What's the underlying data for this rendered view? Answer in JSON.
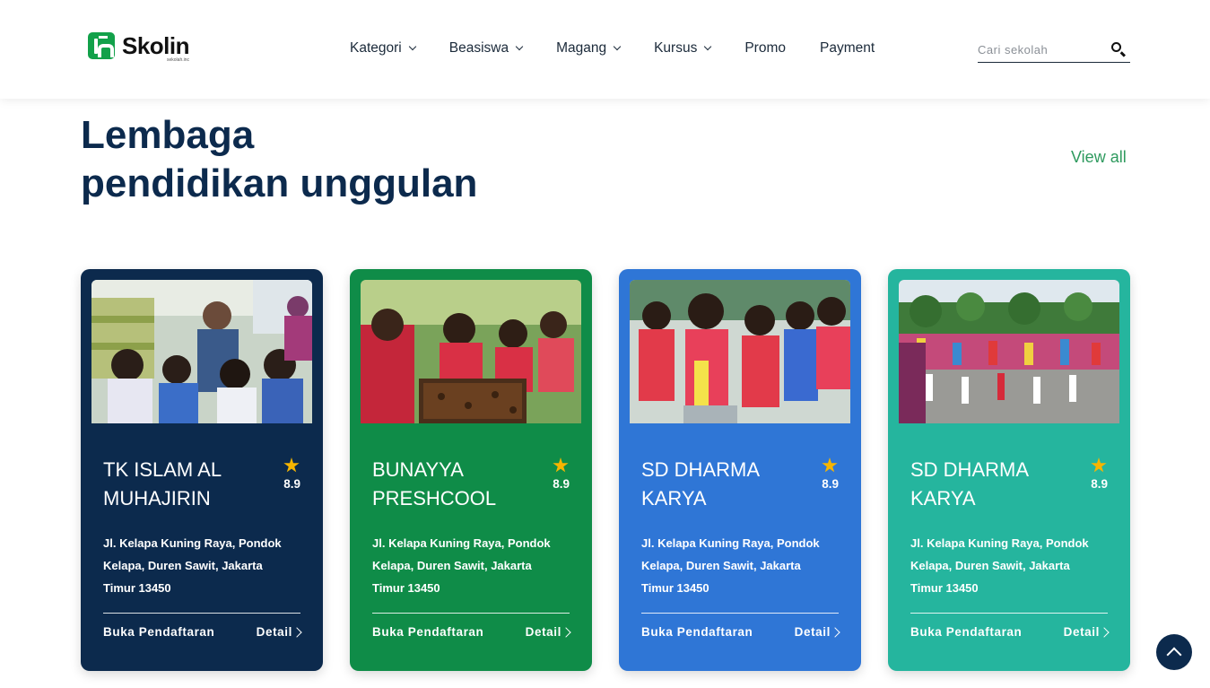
{
  "header": {
    "logo_text": "Skolin",
    "logo_tagline": "sekolah.inc",
    "nav": [
      {
        "label": "Kategori",
        "dropdown": true
      },
      {
        "label": "Beasiswa",
        "dropdown": true
      },
      {
        "label": "Magang",
        "dropdown": true
      },
      {
        "label": "Kursus",
        "dropdown": true
      },
      {
        "label": "Promo",
        "dropdown": false
      },
      {
        "label": "Payment",
        "dropdown": false
      }
    ],
    "search_placeholder": "Cari sekolah",
    "search_icon": "search-icon"
  },
  "section": {
    "title_line1": "Lembaga",
    "title_line2": "pendidikan unggulan",
    "view_all": "View all"
  },
  "cards": [
    {
      "name": "TK ISLAM AL MUHAJIRIN",
      "rating": "8.9",
      "address": "Jl. Kelapa Kuning Raya, Pondok Kelapa, Duren Sawit, Jakarta Timur 13450",
      "status": "Buka Pendaftaran",
      "detail": "Detail",
      "color": "#0c2a4d",
      "image": "children in classroom"
    },
    {
      "name": "BUNAYYA PRESHCOOL",
      "rating": "8.9",
      "address": "Jl. Kelapa Kuning Raya, Pondok Kelapa, Duren Sawit, Jakarta Timur 13450",
      "status": "Buka Pendaftaran",
      "detail": "Detail",
      "color": "#0f8c48",
      "image": "children at beehive"
    },
    {
      "name": "SD DHARMA KARYA",
      "rating": "8.9",
      "address": "Jl. Kelapa Kuning Raya, Pondok Kelapa, Duren Sawit, Jakarta Timur 13450",
      "status": "Buka Pendaftaran",
      "detail": "Detail",
      "color": "#2f76d6",
      "image": "children cooking"
    },
    {
      "name": "SD DHARMA KARYA",
      "rating": "8.9",
      "address": "Jl. Kelapa Kuning Raya, Pondok Kelapa, Duren Sawit, Jakarta Timur 13450",
      "status": "Buka Pendaftaran",
      "detail": "Detail",
      "color": "#25b59e",
      "image": "marching band parade"
    }
  ],
  "colors": {
    "accent_green": "#2e9a5e",
    "title_navy": "#0c2a4d",
    "star": "#f7b500"
  }
}
